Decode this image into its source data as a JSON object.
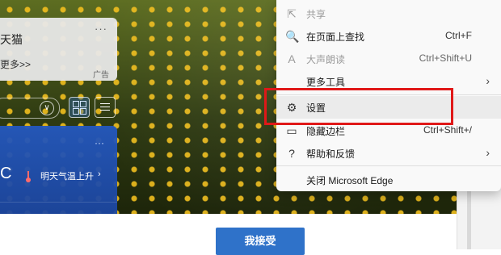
{
  "background_page": {
    "news_card": {
      "title": "天猫",
      "more": "更多>>",
      "ad_label": "广告",
      "menu_dots": "···"
    },
    "weather_card": {
      "temp_unit": "C",
      "forecast_label": "明天气温上升",
      "chevron": "›",
      "menu_dots": "···"
    },
    "accept_button": "我接受"
  },
  "context_menu": {
    "items": [
      {
        "label": "共享",
        "shortcut": "",
        "icon": "share-icon",
        "glyph": "⇱",
        "disabled": true,
        "submenu": false
      },
      {
        "label": "在页面上查找",
        "shortcut": "Ctrl+F",
        "icon": "find-icon",
        "glyph": "🔍",
        "disabled": false,
        "submenu": false
      },
      {
        "label": "大声朗读",
        "shortcut": "Ctrl+Shift+U",
        "icon": "read-aloud-icon",
        "glyph": "A",
        "disabled": true,
        "submenu": false
      },
      {
        "label": "更多工具",
        "shortcut": "",
        "icon": "",
        "glyph": "",
        "disabled": false,
        "submenu": true
      },
      {
        "label": "设置",
        "shortcut": "",
        "icon": "gear-icon",
        "glyph": "⚙",
        "disabled": false,
        "submenu": false,
        "highlighted": true
      },
      {
        "label": "隐藏边栏",
        "shortcut": "Ctrl+Shift+/",
        "icon": "sidebar-icon",
        "glyph": "▭",
        "disabled": false,
        "submenu": false
      },
      {
        "label": "帮助和反馈",
        "shortcut": "",
        "icon": "help-icon",
        "glyph": "?",
        "disabled": false,
        "submenu": true
      },
      {
        "label": "关闭 Microsoft Edge",
        "shortcut": "",
        "icon": "",
        "glyph": "",
        "disabled": false,
        "submenu": false
      }
    ],
    "submenu_arrow": "›"
  },
  "annotation": {
    "highlight_color": "#e01818"
  }
}
